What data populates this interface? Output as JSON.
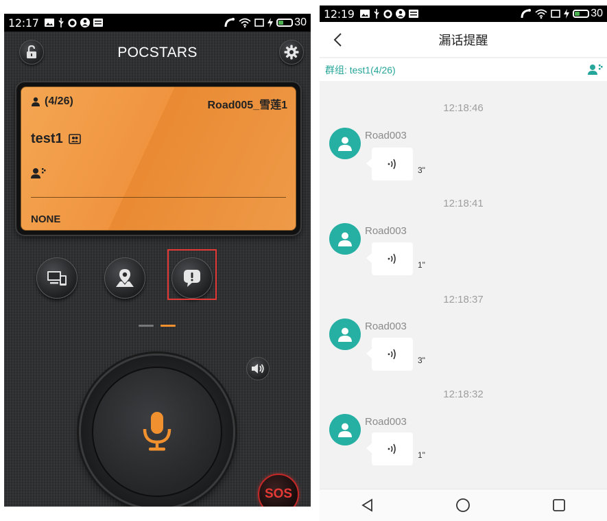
{
  "left": {
    "status": {
      "time": "12:17",
      "battery": "30"
    },
    "title": "POCSTARS",
    "card": {
      "member_count": "(4/26)",
      "user": "Road005_雪莲1",
      "group": "test1",
      "status": "NONE"
    },
    "sos_label": "SOS",
    "colors": {
      "accent": "#f0902e",
      "sos": "#e53935",
      "card": "#ee9a48"
    }
  },
  "right": {
    "status": {
      "time": "12:19",
      "battery": "30"
    },
    "title": "漏话提醒",
    "group_label": "群组: test1(4/26)",
    "messages": [
      {
        "time": "12:18:46",
        "sender": "Road003",
        "duration": "3\""
      },
      {
        "time": "12:18:41",
        "sender": "Road003",
        "duration": "1\""
      },
      {
        "time": "12:18:37",
        "sender": "Road003",
        "duration": "3\""
      },
      {
        "time": "12:18:32",
        "sender": "Road003",
        "duration": "1\""
      }
    ],
    "colors": {
      "accent": "#26a69a",
      "avatar": "#26b0a3"
    }
  }
}
